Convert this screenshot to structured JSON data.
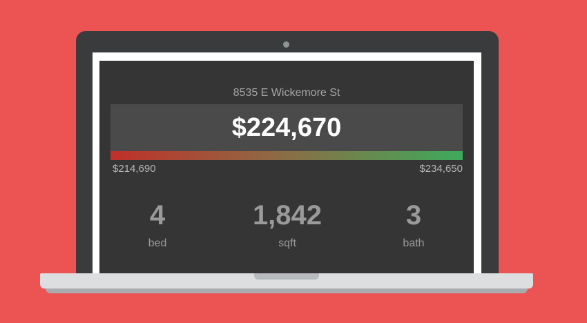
{
  "listing": {
    "address": "8535 E Wickemore St",
    "estimate": "$224,670",
    "estimate_value": 224670,
    "range": {
      "min_label": "$214,690",
      "max_label": "$234,650",
      "min_value": 214690,
      "max_value": 234650,
      "gradient_colors": [
        "#c0302a",
        "#8a6e45",
        "#3eaa5c"
      ]
    },
    "stats": [
      {
        "value": "4",
        "label": "bed"
      },
      {
        "value": "1,842",
        "label": "sqft"
      },
      {
        "value": "3",
        "label": "bath"
      }
    ]
  },
  "colors": {
    "background": "#ec5353",
    "screen": "#353535",
    "price_box": "#4a4a4a"
  }
}
